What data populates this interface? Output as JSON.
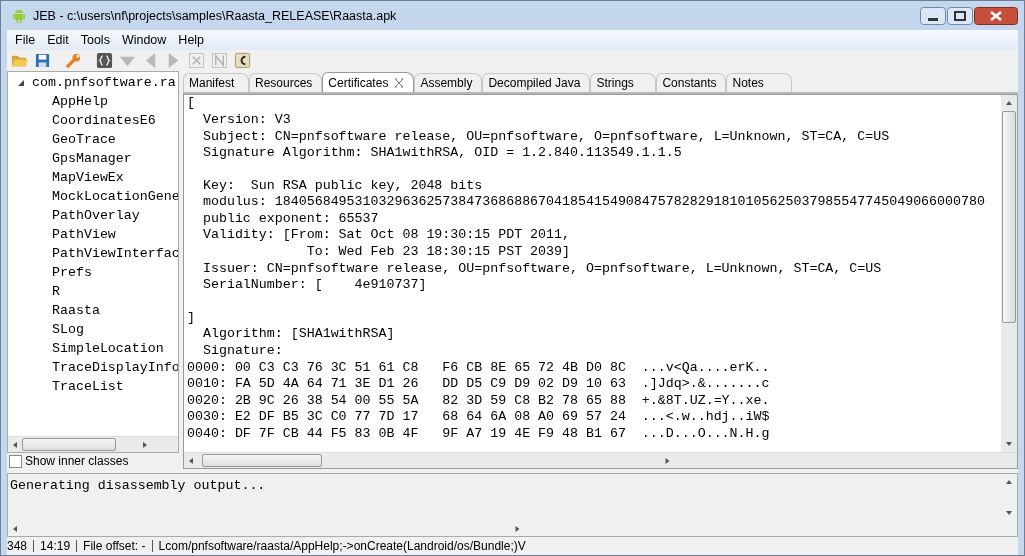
{
  "window": {
    "title": "JEB - c:\\users\\nf\\projects\\samples\\Raasta_RELEASE\\Raasta.apk"
  },
  "menu": [
    "File",
    "Edit",
    "Tools",
    "Window",
    "Help"
  ],
  "toolbar": [
    {
      "kind": "open",
      "disabled": false
    },
    {
      "kind": "save",
      "disabled": false
    },
    {
      "kind": "wrench",
      "disabled": false
    },
    {
      "kind": "braces",
      "disabled": false
    },
    {
      "kind": "down",
      "disabled": true
    },
    {
      "kind": "back",
      "disabled": true
    },
    {
      "kind": "forward",
      "disabled": true
    },
    {
      "kind": "delete",
      "disabled": true
    },
    {
      "kind": "rename",
      "disabled": true
    },
    {
      "kind": "comment",
      "disabled": false
    }
  ],
  "tree": {
    "label": "com.pnfsoftware.ra",
    "expanded": true,
    "children": [
      {
        "label": "AppHelp"
      },
      {
        "label": "CoordinatesE6"
      },
      {
        "label": "GeoTrace"
      },
      {
        "label": "GpsManager"
      },
      {
        "label": "MapViewEx"
      },
      {
        "label": "MockLocationGene"
      },
      {
        "label": "PathOverlay"
      },
      {
        "label": "PathView"
      },
      {
        "label": "PathViewInterfac"
      },
      {
        "label": "Prefs"
      },
      {
        "label": "R"
      },
      {
        "label": "Raasta"
      },
      {
        "label": "SLog"
      },
      {
        "label": "SimpleLocation"
      },
      {
        "label": "TraceDisplayInfo"
      },
      {
        "label": "TraceList"
      }
    ]
  },
  "show_inner_classes": {
    "label": "Show inner classes",
    "checked": false
  },
  "tabs": [
    {
      "label": "Manifest",
      "selected": false
    },
    {
      "label": "Resources",
      "selected": false
    },
    {
      "label": "Certificates",
      "selected": true,
      "closable": true
    },
    {
      "label": "Assembly",
      "selected": false
    },
    {
      "label": "Decompiled Java",
      "selected": false
    },
    {
      "label": "Strings",
      "selected": false
    },
    {
      "label": "Constants",
      "selected": false
    },
    {
      "label": "Notes",
      "selected": false
    }
  ],
  "editor_blocks": [
    [
      "[",
      "  Version: V3",
      "  Subject: CN=pnfsoftware release, OU=pnfsoftware, O=pnfsoftware, L=Unknown, ST=CA, C=US",
      "  Signature Algorithm: SHA1withRSA, OID = 1.2.840.113549.1.1.5"
    ],
    [
      "  Key:  Sun RSA public key, 2048 bits",
      "  modulus: 18405684953103296362573847368688670418541549084757828291810105625037985547745049066000780",
      "  public exponent: 65537",
      "  Validity: [From: Sat Oct 08 19:30:15 PDT 2011,",
      "               To: Wed Feb 23 18:30:15 PST 2039]",
      "  Issuer: CN=pnfsoftware release, OU=pnfsoftware, O=pnfsoftware, L=Unknown, ST=CA, C=US",
      "  SerialNumber: [    4e910737]"
    ],
    [
      "]",
      "  Algorithm: [SHA1withRSA]",
      "  Signature:",
      "0000: 00 C3 C3 76 3C 51 61 C8   F6 CB 8E 65 72 4B D0 8C  ...v<Qa....erK..",
      "0010: FA 5D 4A 64 71 3E D1 26   DD D5 C9 D9 02 D9 10 63  .]Jdq>.&.......c",
      "0020: 2B 9C 26 38 54 00 55 5A   82 3D 59 C8 B2 78 65 88  +.&8T.UZ.=Y..xe.",
      "0030: E2 DF B5 3C C0 77 7D 17   68 64 6A 08 A0 69 57 24  ...<.w..hdj..iW$",
      "0040: DF 7F CB 44 F5 83 0B 4F   9F A7 19 4E F9 48 B1 67  ...D...O...N.H.g"
    ]
  ],
  "console": {
    "text": "Generating disassembly output..."
  },
  "status_bar": [
    "348",
    "14:19",
    "File offset: -",
    "Lcom/pnfsoftware/raasta/AppHelp;->onCreate(Landroid/os/Bundle;)V"
  ]
}
